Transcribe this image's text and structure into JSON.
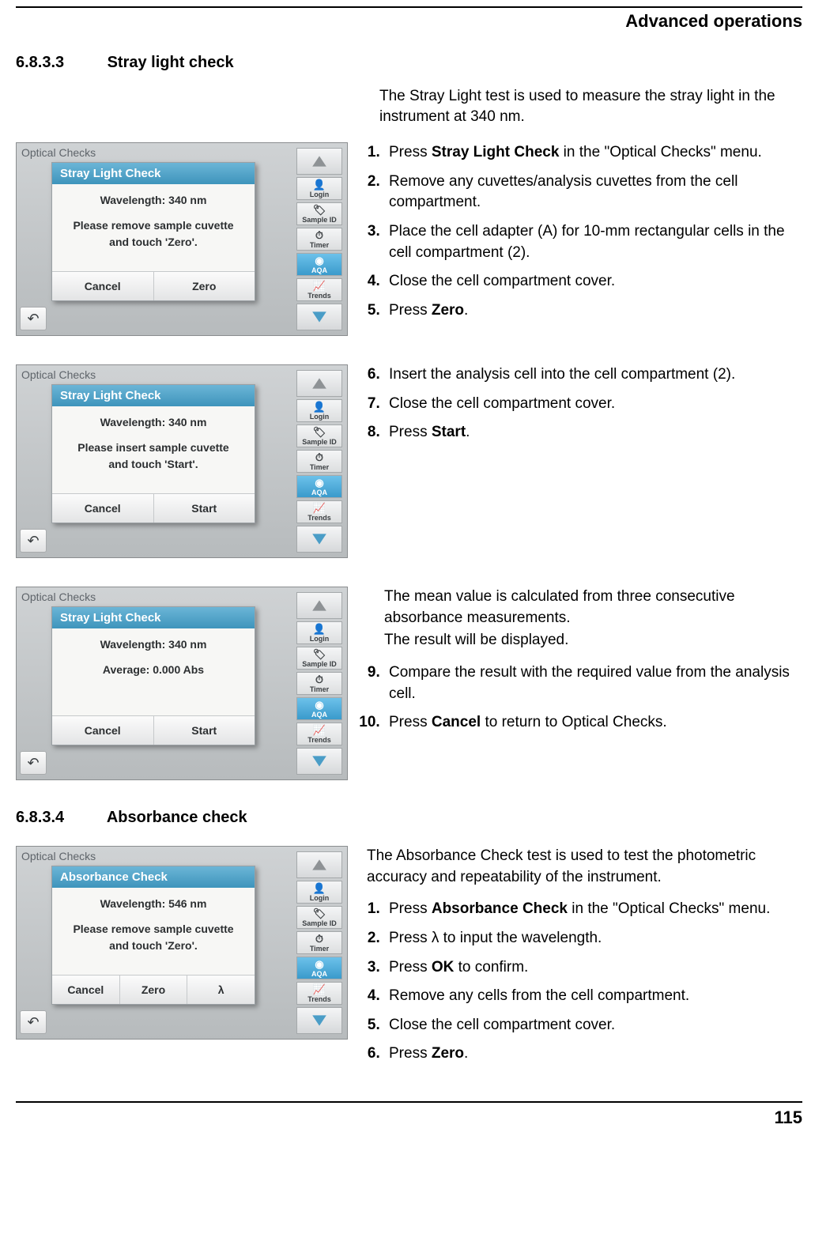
{
  "header": {
    "title": "Advanced operations"
  },
  "footer": {
    "page": "115"
  },
  "sec_a": {
    "num": "6.8.3.3",
    "title": "Stray light check",
    "intro": "The Stray Light test is used to measure the stray light in the instrument at 340 nm."
  },
  "sec_b": {
    "num": "6.8.3.4",
    "title": "Absorbance check",
    "intro": "The Absorbance Check test is used to test the photometric accuracy and repeatability of the instrument."
  },
  "steps_a": {
    "s1a": "Press ",
    "s1b": "Stray Light Check",
    "s1c": " in the \"Optical Checks\" menu.",
    "s2": "Remove any cuvettes/analysis cuvettes from the cell compartment.",
    "s3": "Place the cell adapter (A) for 10-mm rectangular cells in the cell compartment (2).",
    "s4": "Close the cell compartment cover.",
    "s5a": "Press ",
    "s5b": "Zero",
    "s5c": "."
  },
  "steps_b": {
    "s6": "Insert the analysis cell into the cell compartment (2).",
    "s7": "Close the cell compartment cover.",
    "s8a": "Press ",
    "s8b": "Start",
    "s8c": "."
  },
  "steps_c": {
    "p1": "The mean value is calculated from three consecutive absorbance measurements.",
    "p2": "The result will be displayed.",
    "s9": "Compare the result with the required value from the analysis cell.",
    "s10a": "Press ",
    "s10b": "Cancel",
    "s10c": " to return to Optical Checks."
  },
  "steps_d": {
    "s1a": "Press ",
    "s1b": "Absorbance Check",
    "s1c": " in the \"Optical Checks\" menu.",
    "s2": "Press λ to input the wavelength.",
    "s3a": "Press ",
    "s3b": "OK",
    "s3c": " to confirm.",
    "s4": "Remove any cells from the cell compartment.",
    "s5": "Close the cell compartment cover.",
    "s6a": "Press ",
    "s6b": "Zero",
    "s6c": "."
  },
  "shot": {
    "bg_label": "Optical Checks",
    "undo_glyph": "↶",
    "side": {
      "login": "Login",
      "sampleid": "Sample ID",
      "timer": "Timer",
      "aqa": "AQA",
      "trends": "Trends"
    },
    "icons": {
      "login": "👤",
      "sampleid": "🏷",
      "timer": "⏱",
      "aqa": "◉",
      "trends": "📈"
    }
  },
  "dlg1": {
    "title": "Stray Light Check",
    "wl": "Wavelength: 340 nm",
    "msg1": "Please remove sample cuvette",
    "msg2": "and touch 'Zero'.",
    "btn1": "Cancel",
    "btn2": "Zero"
  },
  "dlg2": {
    "title": "Stray Light Check",
    "wl": "Wavelength: 340 nm",
    "msg1": "Please insert sample cuvette",
    "msg2": "and touch 'Start'.",
    "btn1": "Cancel",
    "btn2": "Start"
  },
  "dlg3": {
    "title": "Stray Light Check",
    "wl": "Wavelength: 340 nm",
    "avg": "Average:  0.000 Abs",
    "btn1": "Cancel",
    "btn2": "Start"
  },
  "dlg4": {
    "title": "Absorbance Check",
    "wl": "Wavelength: 546 nm",
    "msg1": "Please remove sample cuvette",
    "msg2": "and touch 'Zero'.",
    "btn1": "Cancel",
    "btn2": "Zero",
    "btn3": "λ"
  }
}
